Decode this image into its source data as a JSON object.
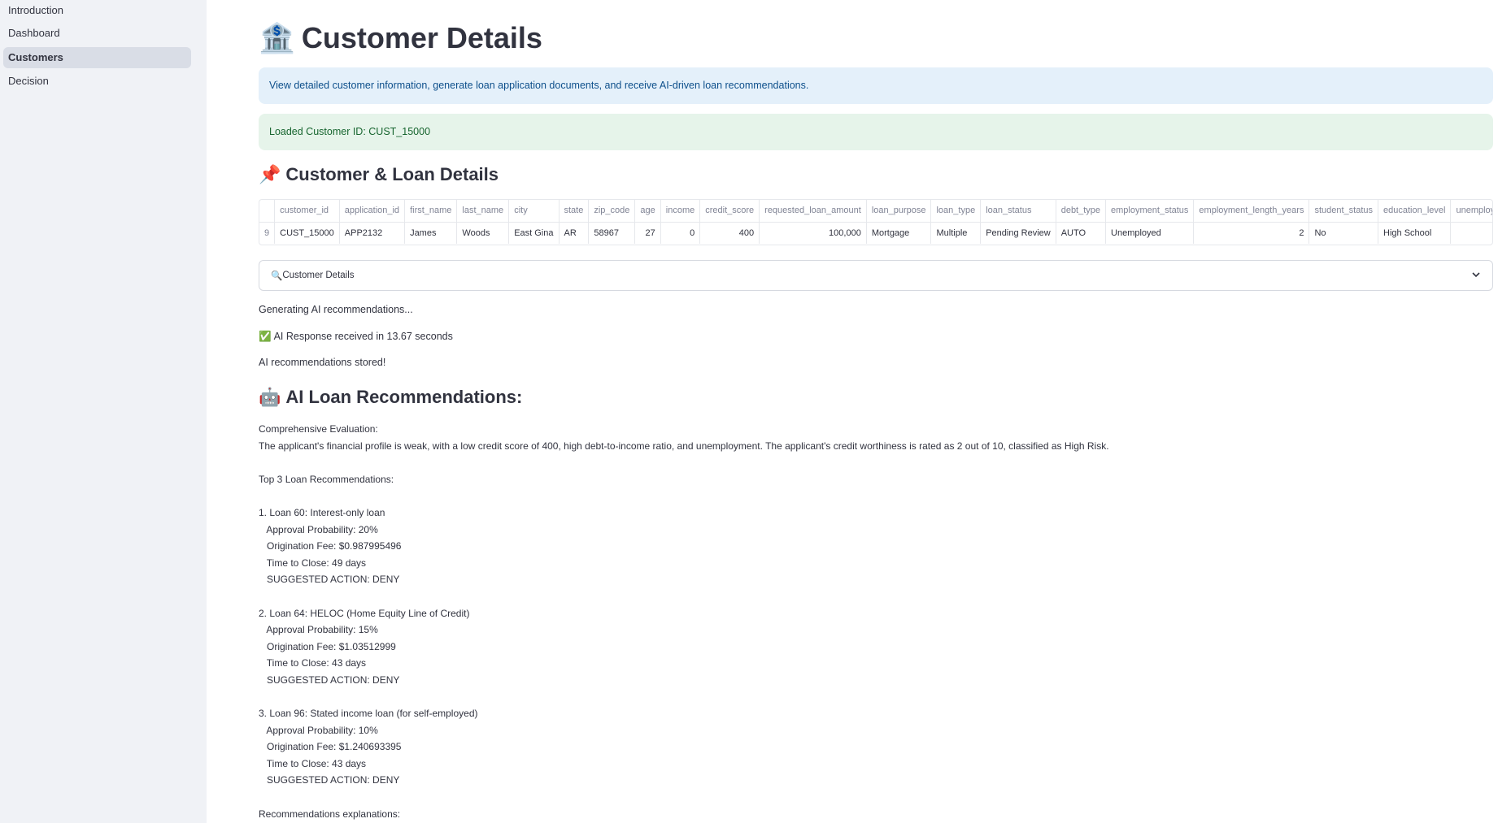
{
  "sidebar": {
    "items": [
      {
        "label": "Introduction",
        "active": false
      },
      {
        "label": "Dashboard",
        "active": false
      },
      {
        "label": "Customers",
        "active": true
      },
      {
        "label": "Decision",
        "active": false
      }
    ]
  },
  "page": {
    "title_icon": "🏦",
    "title": "Customer Details",
    "info_text": "View detailed customer information, generate loan application documents, and receive AI-driven loan recommendations.",
    "success_text": "Loaded Customer ID: CUST_15000"
  },
  "section1": {
    "icon": "📌",
    "title": "Customer & Loan Details"
  },
  "table": {
    "columns": [
      "",
      "customer_id",
      "application_id",
      "first_name",
      "last_name",
      "city",
      "state",
      "zip_code",
      "age",
      "income",
      "credit_score",
      "requested_loan_amount",
      "loan_purpose",
      "loan_type",
      "loan_status",
      "debt_type",
      "employment_status",
      "employment_length_years",
      "student_status",
      "education_level",
      "unemployed"
    ],
    "rows": [
      [
        "9",
        "CUST_15000",
        "APP2132",
        "James",
        "Woods",
        "East Gina",
        "AR",
        "58967",
        "27",
        "0",
        "400",
        "100,000",
        "Mortgage",
        "Multiple",
        "Pending Review",
        "AUTO",
        "Unemployed",
        "2",
        "No",
        "High School",
        ""
      ]
    ]
  },
  "expander": {
    "icon": "🔍",
    "label": "Customer Details"
  },
  "status": {
    "generating": "Generating AI recommendations...",
    "received_icon": "✅",
    "received": "AI Response received in 13.67 seconds",
    "stored": "AI recommendations stored!"
  },
  "section2": {
    "icon": "🤖",
    "title": "AI Loan Recommendations:"
  },
  "recommendations": {
    "text": "Comprehensive Evaluation:\nThe applicant's financial profile is weak, with a low credit score of 400, high debt-to-income ratio, and unemployment. The applicant's credit worthiness is rated as 2 out of 10, classified as High Risk.\n\nTop 3 Loan Recommendations:\n\n1. Loan 60: Interest-only loan\n   Approval Probability: 20%\n   Origination Fee: $0.987995496\n   Time to Close: 49 days\n   SUGGESTED ACTION: DENY\n\n2. Loan 64: HELOC (Home Equity Line of Credit)\n   Approval Probability: 15%\n   Origination Fee: $1.03512999\n   Time to Close: 43 days\n   SUGGESTED ACTION: DENY\n\n3. Loan 96: Stated income loan (for self-employed)\n   Approval Probability: 10%\n   Origination Fee: $1.240693395\n   Time to Close: 43 days\n   SUGGESTED ACTION: DENY\n\nRecommendations explanations:"
  }
}
